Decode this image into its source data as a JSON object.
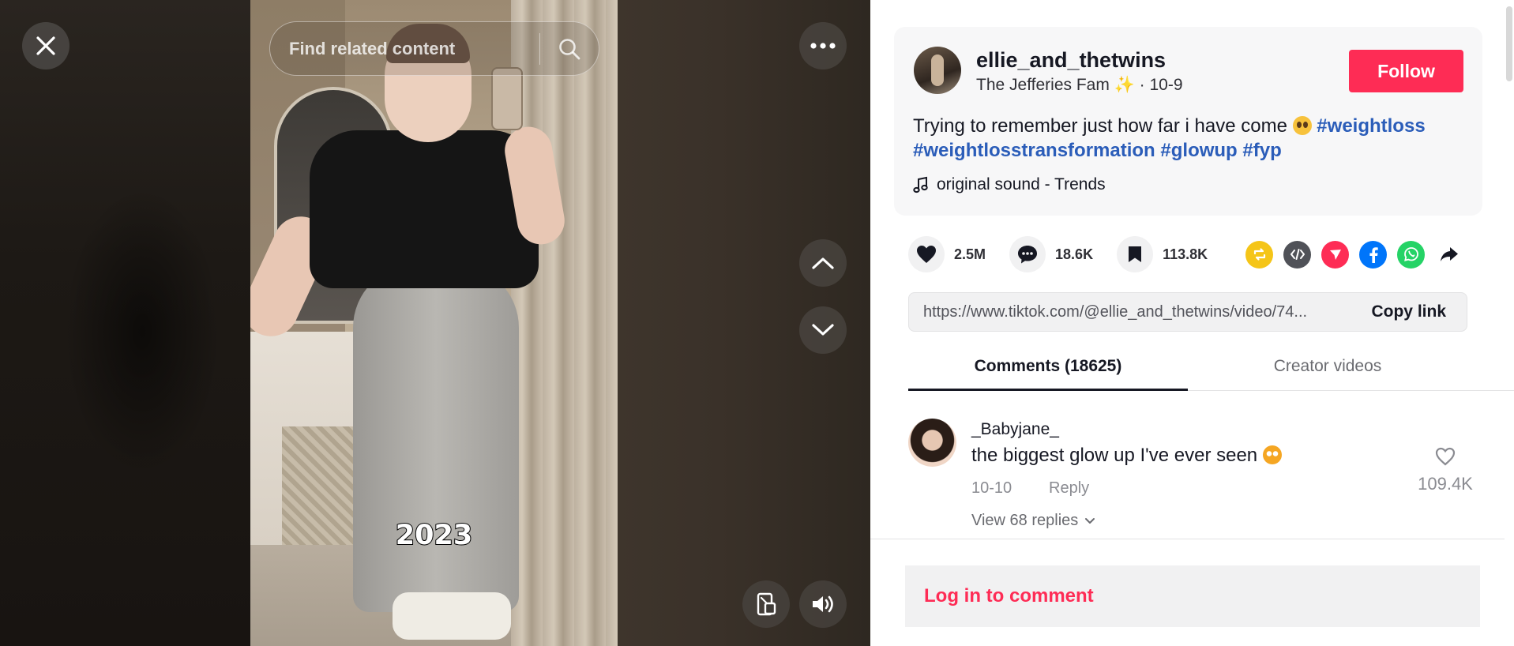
{
  "search": {
    "placeholder": "Find related content"
  },
  "video": {
    "caption": "2023"
  },
  "author": {
    "username": "ellie_and_thetwins",
    "display_name": "The Jefferies Fam ✨",
    "date": "10-9",
    "follow_label": "Follow"
  },
  "caption": {
    "text": "Trying to remember just how far i have come",
    "hashtags": [
      "#weightloss",
      "#weightlosstransformation",
      "#glowup",
      "#fyp"
    ]
  },
  "sound": {
    "label": "original sound - Trends"
  },
  "stats": {
    "likes": "2.5M",
    "comments": "18.6K",
    "saves": "113.8K"
  },
  "share_icons": [
    {
      "name": "repost-icon",
      "color": "#f5c518"
    },
    {
      "name": "embed-icon",
      "color": "#505258"
    },
    {
      "name": "send-to-friends-icon",
      "color": "#fe2c55"
    },
    {
      "name": "facebook-icon",
      "color": "#0075fa"
    },
    {
      "name": "whatsapp-icon",
      "color": "#25d366"
    },
    {
      "name": "share-arrow-icon",
      "color": "#161823"
    }
  ],
  "link": {
    "url": "https://www.tiktok.com/@ellie_and_thetwins/video/74...",
    "copy_label": "Copy link"
  },
  "tabs": {
    "comments": "Comments (18625)",
    "creator_videos": "Creator videos"
  },
  "comment": {
    "username": "_Babyjane_",
    "text": "the biggest glow up I've ever seen",
    "date": "10-10",
    "reply_label": "Reply",
    "likes": "109.4K",
    "view_replies": "View 68 replies"
  },
  "login": {
    "label": "Log in to comment"
  },
  "colors": {
    "brand": "#fe2c55",
    "hashtag": "#2b5db9"
  }
}
